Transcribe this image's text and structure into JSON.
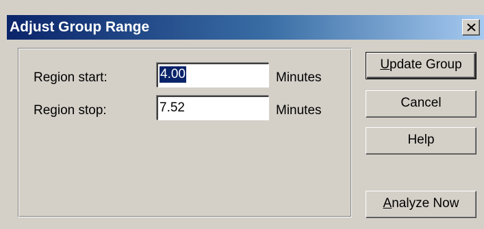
{
  "window": {
    "title": "Adjust Group Range",
    "close_glyph": "✕"
  },
  "fields": {
    "region_start": {
      "label": "Region start:",
      "value": "4.00",
      "unit": "Minutes"
    },
    "region_stop": {
      "label": "Region stop:",
      "value": "7.52",
      "unit": "Minutes"
    }
  },
  "buttons": {
    "update_group": {
      "mnemonic": "U",
      "rest": "pdate Group"
    },
    "cancel": {
      "label": "Cancel"
    },
    "help": {
      "label": "Help"
    },
    "analyze_now": {
      "mnemonic": "A",
      "rest": "nalyze Now"
    }
  },
  "colors": {
    "face": "#d4d0c8",
    "title_start": "#0a246a",
    "title_end": "#a6caf0",
    "selection": "#0a246a"
  },
  "icons": {
    "close": "close-icon"
  }
}
